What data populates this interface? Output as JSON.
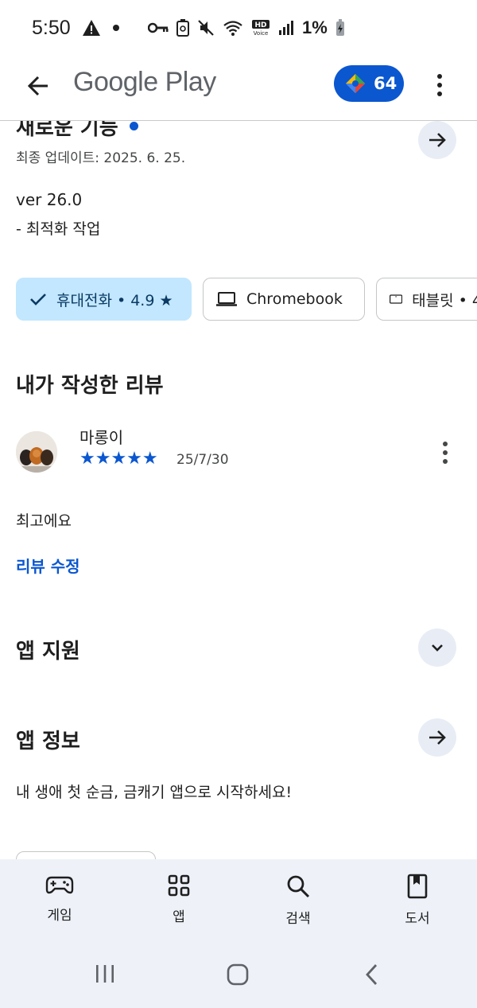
{
  "status_bar": {
    "time": "5:50",
    "battery_percent": "1%",
    "icons": [
      "warning-icon",
      "dot-icon",
      "vpn-key-icon",
      "recycle-icon",
      "mute-icon",
      "wifi-icon",
      "hd-voice-icon",
      "signal-icon",
      "battery-charging-icon"
    ]
  },
  "app_bar": {
    "title": "Google Play",
    "points_value": "64"
  },
  "whats_new": {
    "title": "새로운 기능",
    "updated": "최종 업데이트: 2025. 6. 25.",
    "version": "ver 26.0",
    "note": "- 최적화 작업"
  },
  "device_chips": [
    {
      "label": "휴대전화 • 4.9 ★",
      "selected": true,
      "icon": "check-icon"
    },
    {
      "label": "Chromebook",
      "selected": false,
      "icon": "laptop-icon"
    },
    {
      "label": "태블릿 • 4",
      "selected": false,
      "icon": "tablet-icon"
    }
  ],
  "my_review": {
    "heading": "내가 작성한 리뷰",
    "reviewer_name": "마롱이",
    "rating": 5,
    "stars": "★★★★★",
    "date": "25/7/30",
    "body": "최고에요",
    "edit_label": "리뷰 수정"
  },
  "app_support": {
    "heading": "앱 지원"
  },
  "app_info": {
    "heading": "앱 정보",
    "description": "내 생애 첫 순금, 금캐기 앱으로 시작하세요!"
  },
  "bottom_nav": {
    "items": [
      {
        "label": "게임",
        "icon": "gamepad-icon"
      },
      {
        "label": "앱",
        "icon": "apps-grid-icon"
      },
      {
        "label": "검색",
        "icon": "search-icon"
      },
      {
        "label": "도서",
        "icon": "book-icon"
      }
    ]
  },
  "colors": {
    "accent": "#0b57d0",
    "chip_selected_bg": "#c2e7ff",
    "nav_bg": "#eef2f8"
  }
}
